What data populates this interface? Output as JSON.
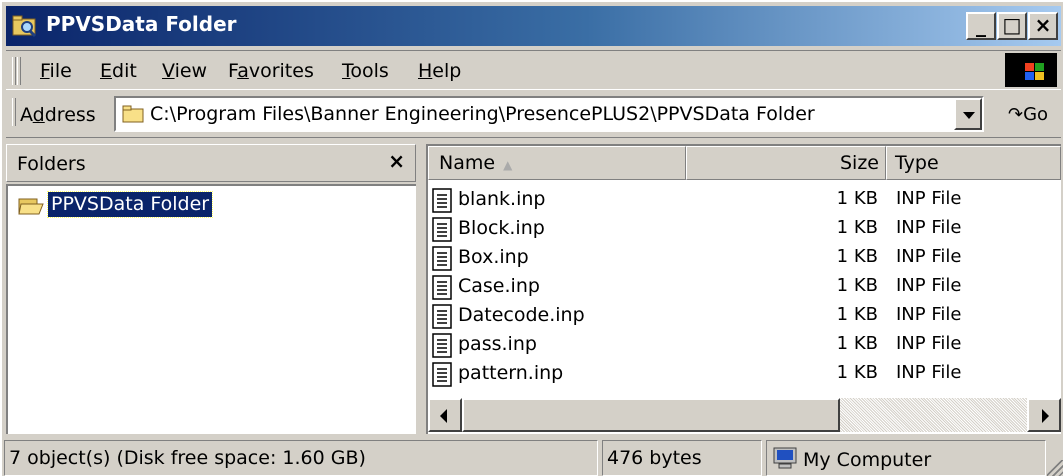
{
  "window": {
    "title": "PPVSData Folder",
    "controls": {
      "minimize": "_",
      "maximize": "□",
      "close": "×"
    }
  },
  "menubar": {
    "items": [
      {
        "label": "File",
        "mnemonic": "F"
      },
      {
        "label": "Edit",
        "mnemonic": "E"
      },
      {
        "label": "View",
        "mnemonic": "V"
      },
      {
        "label": "Favorites",
        "mnemonic": "a"
      },
      {
        "label": "Tools",
        "mnemonic": "T"
      },
      {
        "label": "Help",
        "mnemonic": "H"
      }
    ]
  },
  "address": {
    "label": "Address",
    "value": "C:\\Program Files\\Banner Engineering\\PresencePLUS2\\PPVSData Folder",
    "go_label": "Go"
  },
  "folders_pane": {
    "title": "Folders",
    "close": "×",
    "tree": [
      {
        "label": "PPVSData Folder",
        "selected": true
      }
    ]
  },
  "file_list": {
    "columns": {
      "name": "Name",
      "size": "Size",
      "type": "Type"
    },
    "sort_indicator": "▲",
    "rows": [
      {
        "name": "blank.inp",
        "size": "1 KB",
        "type": "INP File"
      },
      {
        "name": "Block.inp",
        "size": "1 KB",
        "type": "INP File"
      },
      {
        "name": "Box.inp",
        "size": "1 KB",
        "type": "INP File"
      },
      {
        "name": "Case.inp",
        "size": "1 KB",
        "type": "INP File"
      },
      {
        "name": "Datecode.inp",
        "size": "1 KB",
        "type": "INP File"
      },
      {
        "name": "pass.inp",
        "size": "1 KB",
        "type": "INP File"
      },
      {
        "name": "pattern.inp",
        "size": "1 KB",
        "type": "INP File"
      }
    ]
  },
  "statusbar": {
    "objects": "7 object(s) (Disk free space: 1.60 GB)",
    "size": "476 bytes",
    "zone": "My Computer"
  },
  "colors": {
    "titlebar_start": "#0a246a",
    "titlebar_end": "#a6caf0",
    "selection": "#0a246a",
    "chrome": "#d4d0c8"
  }
}
